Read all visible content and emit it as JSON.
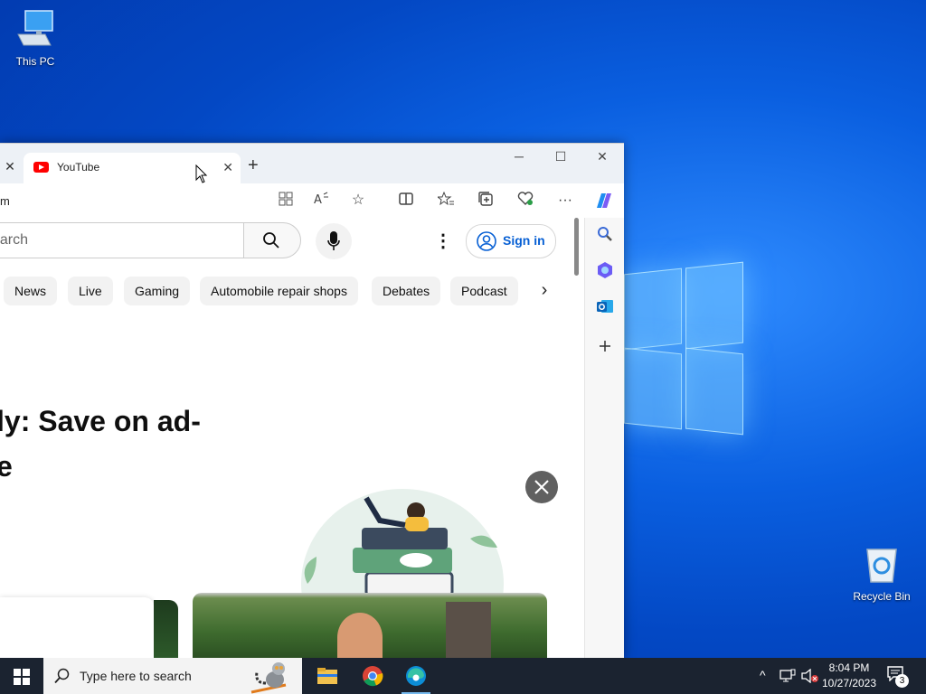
{
  "desktop": {
    "icons": [
      {
        "label": "This PC"
      },
      {
        "label": "Recycle Bin"
      }
    ]
  },
  "browser": {
    "tab": {
      "title": "YouTube"
    },
    "address_text": "m",
    "side_pane": [
      "search-icon",
      "copilot-hex-icon",
      "outlook-icon",
      "add-icon"
    ]
  },
  "youtube": {
    "search_placeholder": "earch",
    "sign_in": "Sign in",
    "chips": [
      "News",
      "Live",
      "Gaming",
      "Automobile repair shops",
      "Debates",
      "Podcast"
    ],
    "promo_line1": "ly: Save on ad-",
    "promo_line2": "e"
  },
  "taskbar": {
    "search_placeholder": "Type here to search",
    "time": "8:04 PM",
    "date": "10/27/2023",
    "notifications": "3"
  },
  "colors": {
    "accent": "#065fd4",
    "youtube_red": "#ff0000",
    "taskbar": "#1b2330"
  }
}
